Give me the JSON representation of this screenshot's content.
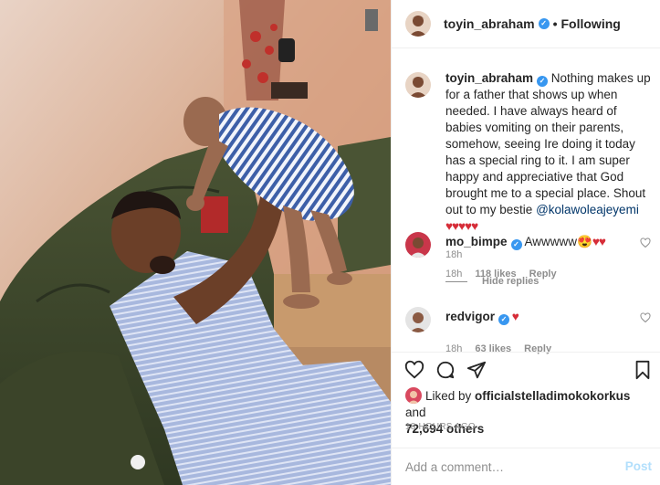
{
  "post": {
    "author": "toyin_abraham",
    "follow_status": "Following",
    "dot": "•",
    "more_icon": "more-horizontal-icon",
    "caption": {
      "username": "toyin_abraham",
      "text": " Nothing makes up for a father that shows up when needed. I have always heard of babies vomiting on their parents, somehow, seeing Ire doing it today has a special ring to it. I am super happy and appreciative that God brought me to a special place. Shout out to my bestie ",
      "mention": "@kolawoleajeyemi",
      "hearts": " ♥♥♥♥♥",
      "time": "18h"
    },
    "comments": [
      {
        "username": "mo_bimpe",
        "text": " Awwwww",
        "emoji": "😍",
        "hearts": "♥♥",
        "time": "18h",
        "likes": "118 likes",
        "reply": "Reply"
      },
      {
        "username": "redvigor",
        "hearts": " ♥",
        "time": "18h",
        "likes": "63 likes",
        "reply": "Reply"
      }
    ],
    "hide_replies": "Hide replies",
    "liked_by_prefix": "Liked by ",
    "liked_by_user": "officialstelladimokokorkus",
    "liked_by_and": " and",
    "liked_by_count": "72,694 others",
    "posted_ago": "18 HOURS AGO",
    "add_comment_placeholder": "Add a comment…",
    "post_button": "Post",
    "icons": {
      "like": "heart-icon",
      "comment": "comment-icon",
      "share": "share-icon",
      "save": "bookmark-icon",
      "verified": "verified-badge-icon"
    },
    "colors": {
      "verified": "#3897f0",
      "heart": "#d62d38",
      "muted": "#8e8e8e",
      "link": "#003569",
      "post_disabled": "#b2dffc"
    }
  }
}
